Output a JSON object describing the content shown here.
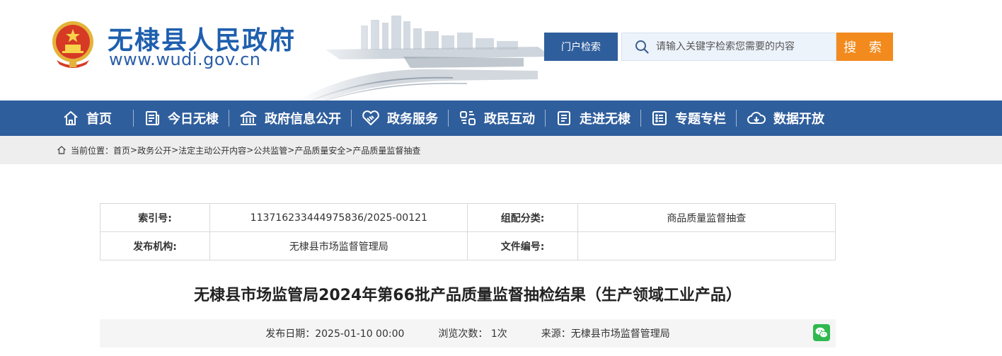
{
  "site": {
    "title": "无棣县人民政府",
    "url": "www.wudi.gov.cn"
  },
  "search": {
    "portal_label": "门户检索",
    "placeholder": "请输入关键字检索您需要的内容",
    "button_label": "搜 索"
  },
  "nav": {
    "items": [
      {
        "label": "首页",
        "icon": "home-icon"
      },
      {
        "label": "今日无棣",
        "icon": "newspaper-icon"
      },
      {
        "label": "政府信息公开",
        "icon": "building-icon"
      },
      {
        "label": "政务服务",
        "icon": "handshake-icon"
      },
      {
        "label": "政民互动",
        "icon": "interaction-icon"
      },
      {
        "label": "走进无棣",
        "icon": "document-list-icon"
      },
      {
        "label": "专题专栏",
        "icon": "list-icon"
      },
      {
        "label": "数据开放",
        "icon": "cloud-download-icon"
      }
    ]
  },
  "breadcrumb": {
    "prefix": "当前位置：",
    "items": [
      "首页",
      "政务公开",
      "法定主动公开内容",
      "公共监管",
      "产品质量安全",
      "产品质量监督抽查"
    ],
    "separator": ">"
  },
  "meta": {
    "index_label": "索引号:",
    "index_value": "113716233444975836/2025-00121",
    "category_label": "组配分类:",
    "category_value": "商品质量监督抽查",
    "publisher_label": "发布机构:",
    "publisher_value": "无棣县市场监督管理局",
    "doc_no_label": "文件编号:",
    "doc_no_value": ""
  },
  "article": {
    "title": "无棣县市场监管局2024年第66批产品质量监督抽检结果（生产领域工业产品）",
    "publish_date": "发布日期：2025-01-10 00:00",
    "views": "浏览次数： 1次",
    "source": "来源：无棣县市场监督管理局"
  },
  "colors": {
    "primary": "#2f5e9c",
    "accent": "#f28a1e",
    "title_blue": "#1e5fae"
  }
}
